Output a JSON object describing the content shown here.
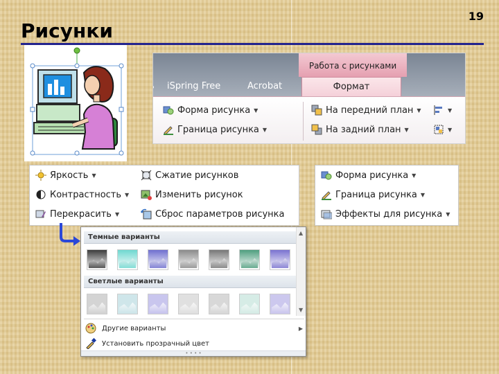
{
  "slide": {
    "number": "19",
    "title": "Рисунки"
  },
  "ribbon": {
    "context_header": "Работа с рисунками",
    "tabs": [
      {
        "label": "iSpring Free"
      },
      {
        "label": "Acrobat"
      }
    ],
    "active_tab": "Формат",
    "left_group": [
      {
        "label": "Форма рисунка"
      },
      {
        "label": "Граница рисунка"
      }
    ],
    "right_group": [
      {
        "label": "На передний план"
      },
      {
        "label": "На задний план"
      }
    ]
  },
  "adjust_panel": {
    "left": [
      {
        "label": "Яркость"
      },
      {
        "label": "Контрастность"
      },
      {
        "label": "Перекрасить"
      }
    ],
    "right": [
      {
        "label": "Сжатие рисунков"
      },
      {
        "label": "Изменить рисунок"
      },
      {
        "label": "Сброс параметров рисунка"
      }
    ]
  },
  "styles_panel": {
    "items": [
      {
        "label": "Форма рисунка"
      },
      {
        "label": "Граница рисунка"
      },
      {
        "label": "Эффекты для рисунка"
      }
    ]
  },
  "recolor_gallery": {
    "dark_header": "Темные варианты",
    "light_header": "Светлые варианты",
    "dark_swatch_colors": [
      "#3c3c3c",
      "#6fd8d0",
      "#6f6fcf",
      "#8a8a8a",
      "#777777",
      "#4f9f7f",
      "#7a72d0"
    ],
    "light_swatch_colors": [
      "#d4d4d4",
      "#cfe6ea",
      "#c9c6ee",
      "#e0e0e0",
      "#d8d8d8",
      "#d6ece6",
      "#ccc8ee"
    ],
    "more_variants": "Другие варианты",
    "set_transparent": "Установить прозрачный цвет"
  },
  "colors": {
    "title_rule": "#23238e",
    "connector_arrow": "#2a47d8",
    "context_tab": "#e5a0b1"
  }
}
